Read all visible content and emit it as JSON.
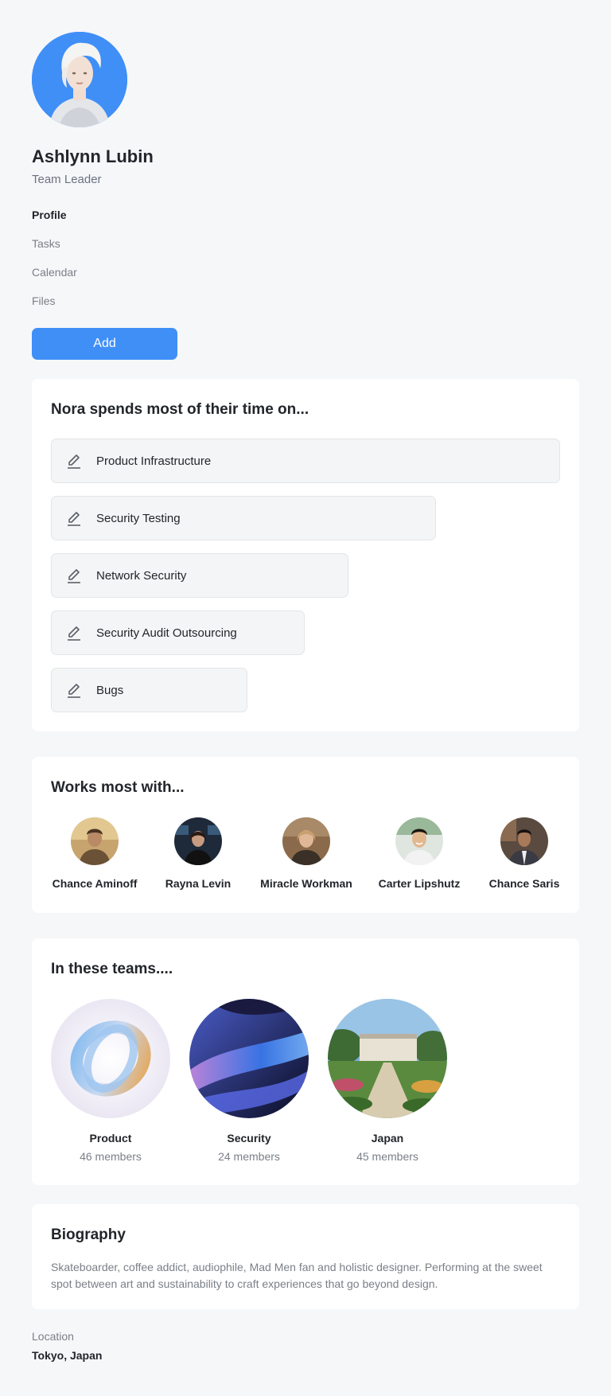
{
  "profile": {
    "name": "Ashlynn Lubin",
    "role": "Team Leader",
    "avatar_bg": "#3f8ff7"
  },
  "nav": {
    "items": [
      {
        "label": "Profile",
        "active": true
      },
      {
        "label": "Tasks",
        "active": false
      },
      {
        "label": "Calendar",
        "active": false
      },
      {
        "label": "Files",
        "active": false
      }
    ]
  },
  "add_button": {
    "label": "Add",
    "color": "#3f8ff7"
  },
  "time_section": {
    "title": "Nora spends most of their time on...",
    "icon": "pencil-icon",
    "topics": [
      {
        "label": "Product Infrastructure"
      },
      {
        "label": "Security Testing"
      },
      {
        "label": "Network Security"
      },
      {
        "label": "Security Audit Outsourcing"
      },
      {
        "label": "Bugs"
      }
    ]
  },
  "works_section": {
    "title": "Works most with...",
    "people": [
      {
        "name": "Chance Aminoff"
      },
      {
        "name": "Rayna Levin"
      },
      {
        "name": "Miracle Workman"
      },
      {
        "name": "Carter Lipshutz"
      },
      {
        "name": "Chance Saris"
      }
    ]
  },
  "teams_section": {
    "title": "In these teams....",
    "teams": [
      {
        "name": "Product",
        "members": "46 members"
      },
      {
        "name": "Security",
        "members": "24 members"
      },
      {
        "name": "Japan",
        "members": "45 members"
      }
    ]
  },
  "biography": {
    "title": "Biography",
    "text": "Skateboarder, coffee addict, audiophile, Mad Men fan and holistic designer. Performing at the sweet spot between art and sustainability to craft experiences that go beyond design."
  },
  "location": {
    "label": "Location",
    "value": "Tokyo, Japan"
  }
}
